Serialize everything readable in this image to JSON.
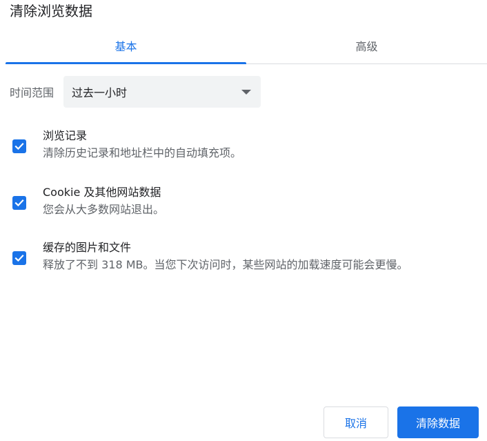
{
  "dialog": {
    "title": "清除浏览数据"
  },
  "tabs": [
    {
      "label": "基本",
      "active": true
    },
    {
      "label": "高级",
      "active": false
    }
  ],
  "time_range": {
    "label": "时间范围",
    "selected": "过去一小时"
  },
  "options": [
    {
      "title": "浏览记录",
      "description": "清除历史记录和地址栏中的自动填充项。",
      "checked": true
    },
    {
      "title": "Cookie 及其他网站数据",
      "description": "您会从大多数网站退出。",
      "checked": true
    },
    {
      "title": "缓存的图片和文件",
      "description": "释放了不到 318 MB。当您下次访问时，某些网站的加载速度可能会更慢。",
      "checked": true
    }
  ],
  "buttons": {
    "cancel": "取消",
    "clear": "清除数据"
  },
  "colors": {
    "accent": "#1a73e8",
    "secondary_text": "#5f6368",
    "select_bg": "#f1f3f4"
  }
}
